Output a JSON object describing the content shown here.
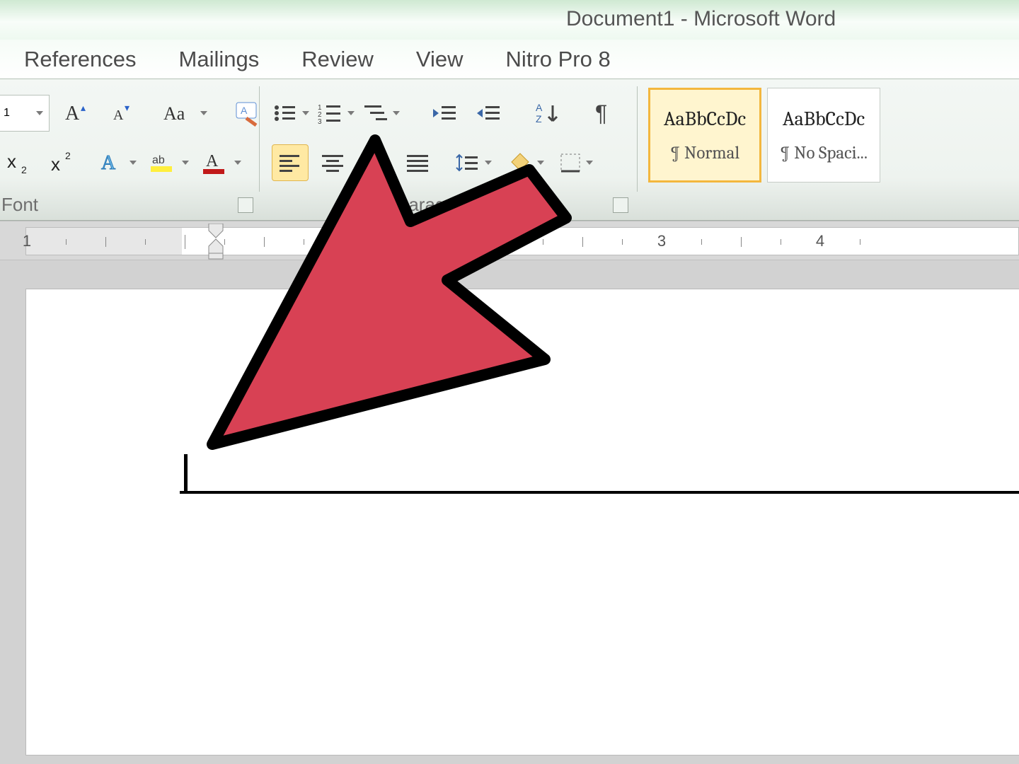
{
  "title": "Document1 - Microsoft Word",
  "tabs": [
    "References",
    "Mailings",
    "Review",
    "View",
    "Nitro Pro 8"
  ],
  "font": {
    "size_value": "1",
    "group_label": "Font"
  },
  "paragraph": {
    "group_label": "Paragraph"
  },
  "styles": [
    {
      "preview": "AaBbCcDc",
      "name": "¶ Normal"
    },
    {
      "preview": "AaBbCcDc",
      "name": "¶ No Spaci..."
    }
  ],
  "ruler": {
    "numbers": [
      "1",
      "3",
      "4"
    ]
  },
  "colors": {
    "highlight": "#ffe9a3",
    "highlight_border": "#e0b54e",
    "arrow_fill": "#d84154",
    "arrow_stroke": "#000000"
  }
}
